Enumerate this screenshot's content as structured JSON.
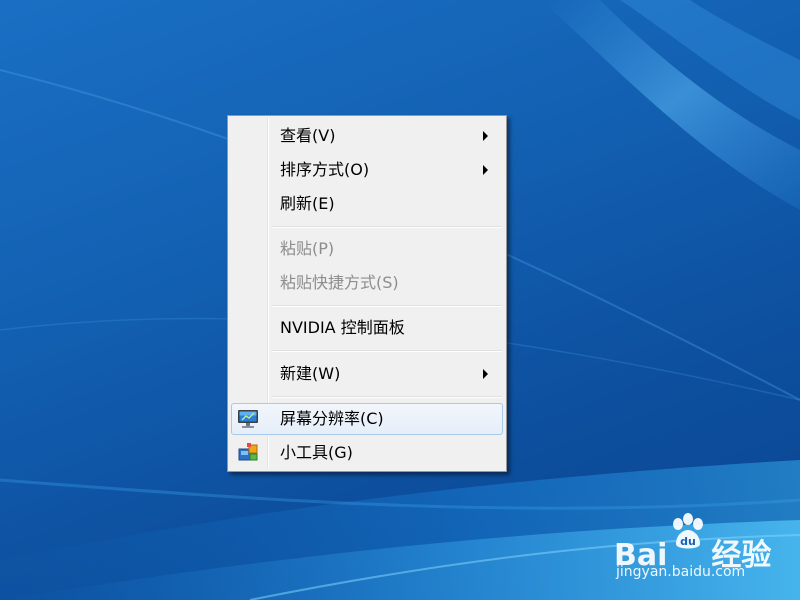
{
  "desktop": {
    "colors": {
      "background": "#1361b3",
      "menu_background": "#f0f0f0",
      "hover_border": "#a8c8ec",
      "disabled_text": "#8d8d8d"
    }
  },
  "context_menu": {
    "items": [
      {
        "label": "查看(V)",
        "has_submenu": true,
        "disabled": false
      },
      {
        "label": "排序方式(O)",
        "has_submenu": true,
        "disabled": false
      },
      {
        "label": "刷新(E)",
        "has_submenu": false,
        "disabled": false
      },
      {
        "label": "粘贴(P)",
        "has_submenu": false,
        "disabled": true
      },
      {
        "label": "粘贴快捷方式(S)",
        "has_submenu": false,
        "disabled": true
      },
      {
        "label": "NVIDIA 控制面板",
        "has_submenu": false,
        "disabled": false
      },
      {
        "label": "新建(W)",
        "has_submenu": true,
        "disabled": false
      },
      {
        "label": "屏幕分辨率(C)",
        "has_submenu": false,
        "disabled": false,
        "highlighted": true,
        "icon": "monitor-icon"
      },
      {
        "label": "小工具(G)",
        "has_submenu": false,
        "disabled": false,
        "icon": "gadgets-icon"
      }
    ]
  },
  "watermark": {
    "brand_left": "Bai",
    "brand_right": "经验",
    "url": "jingyan.baidu.com",
    "icon": "baidu-paw-icon"
  }
}
